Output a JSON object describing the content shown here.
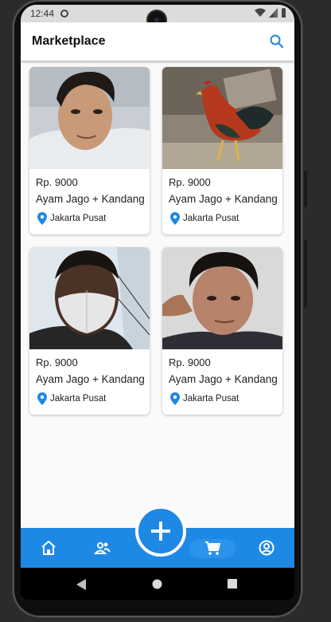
{
  "status": {
    "time": "12:44"
  },
  "appbar": {
    "title": "Marketplace"
  },
  "products": [
    {
      "price": "Rp. 9000",
      "title": "Ayam Jago + Kandang",
      "location": "Jakarta Pusat",
      "image": "man-selfie-photo"
    },
    {
      "price": "Rp. 9000",
      "title": "Ayam Jago + Kandang",
      "location": "Jakarta Pusat",
      "image": "rooster-photo"
    },
    {
      "price": "Rp. 9000",
      "title": "Ayam Jago + Kandang",
      "location": "Jakarta Pusat",
      "image": "man-with-mask-photo"
    },
    {
      "price": "Rp. 9000",
      "title": "Ayam Jago + Kandang",
      "location": "Jakarta Pusat",
      "image": "young-man-selfie-photo"
    }
  ],
  "bottom_nav": {
    "items": [
      "home-icon",
      "people-icon",
      "add-icon",
      "cart-icon",
      "account-icon"
    ]
  },
  "colors": {
    "primary": "#1e88e5",
    "pin": "#1e88e5",
    "background": "#fafafa"
  }
}
